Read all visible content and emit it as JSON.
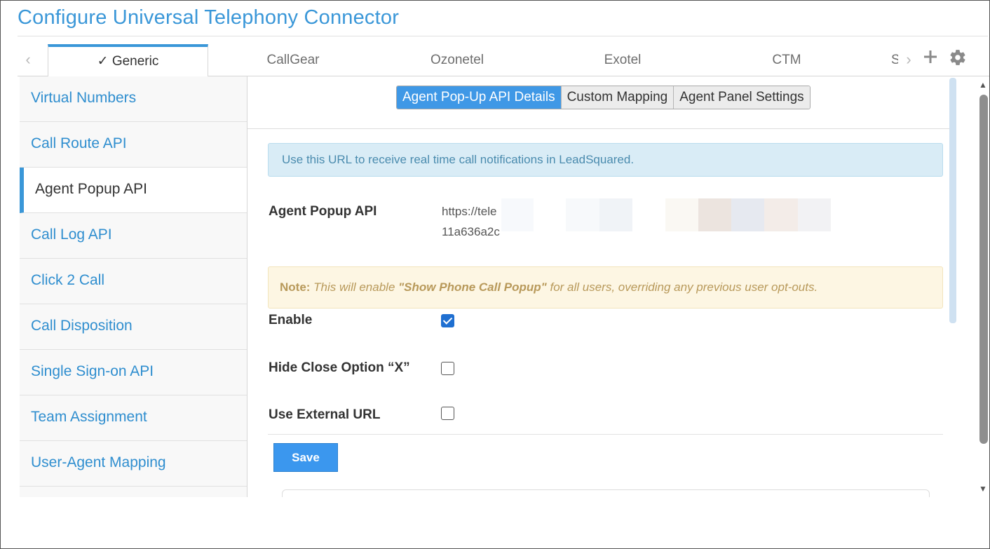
{
  "page": {
    "title": "Configure Universal Telephony Connector"
  },
  "tabs": {
    "items": [
      {
        "label": "✓ Generic",
        "active": true
      },
      {
        "label": "CallGear"
      },
      {
        "label": "Ozonetel"
      },
      {
        "label": "Exotel"
      },
      {
        "label": "CTM"
      },
      {
        "label": "S"
      }
    ],
    "icons": {
      "prev": "chevron-left-icon",
      "next": "chevron-right-icon",
      "add": "plus-icon",
      "settings": "gear-icon"
    }
  },
  "sidebar": {
    "items": [
      {
        "label": "Virtual Numbers"
      },
      {
        "label": "Call Route API"
      },
      {
        "label": "Agent Popup API",
        "active": true
      },
      {
        "label": "Call Log API"
      },
      {
        "label": "Click 2 Call"
      },
      {
        "label": "Call Disposition"
      },
      {
        "label": "Single Sign-on API"
      },
      {
        "label": "Team Assignment"
      },
      {
        "label": "User-Agent Mapping"
      }
    ]
  },
  "subtabs": {
    "items": [
      {
        "label": "Agent Pop-Up API Details",
        "active": true
      },
      {
        "label": "Custom Mapping"
      },
      {
        "label": "Agent Panel Settings"
      }
    ]
  },
  "info": {
    "text": "Use this URL to receive real time call notifications in LeadSquared."
  },
  "api": {
    "label": "Agent Popup API",
    "url_line1": "https://tele",
    "url_line2": "11a636a2c"
  },
  "note": {
    "lead": "Note:",
    "text1": " This will enable ",
    "quoted": "\"Show Phone Call Popup\"",
    "text2": " for all users, overriding any previous user opt-outs."
  },
  "fields": {
    "enable": {
      "label": "Enable",
      "checked": true
    },
    "hide_close": {
      "label": "Hide Close Option “X”",
      "checked": false
    },
    "external_url": {
      "label": "Use External URL",
      "checked": false
    }
  },
  "actions": {
    "save": "Save"
  },
  "colors": {
    "accent": "#3a97d8",
    "button": "#3b97ee",
    "info_bg": "#d9ecf6",
    "note_bg": "#fdf6e3"
  }
}
